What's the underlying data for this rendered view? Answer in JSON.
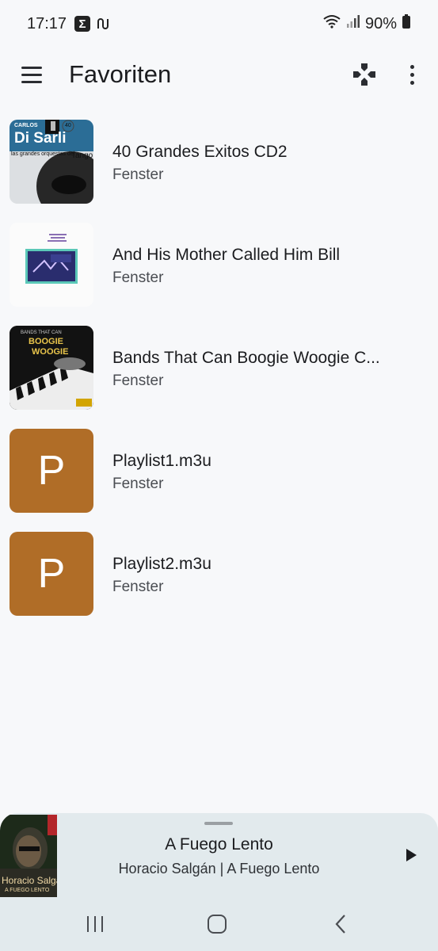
{
  "status": {
    "time": "17:17",
    "sigma_glyph": "Σ",
    "battery": "90%"
  },
  "appbar": {
    "title": "Favoriten"
  },
  "list": [
    {
      "title": "40 Grandes Exitos CD2",
      "subtitle": "Fenster"
    },
    {
      "title": "And His Mother Called Him Bill",
      "subtitle": "Fenster"
    },
    {
      "title": "Bands That Can Boogie Woogie C...",
      "subtitle": "Fenster"
    },
    {
      "title": "Playlist1.m3u",
      "subtitle": "Fenster",
      "letter": "P",
      "color": "#b06d27"
    },
    {
      "title": "Playlist2.m3u",
      "subtitle": "Fenster",
      "letter": "P",
      "color": "#b06d27"
    }
  ],
  "cover_text": {
    "disarli_artist": "CARLOS",
    "disarli_name": "Di Sarli",
    "disarli_sub": "las grandes orquestas del",
    "disarli_genre": "Tango",
    "disarli_num": "40",
    "boogie_band": "BANDS THAT CAN",
    "boogie_title1": "BOOGIE",
    "boogie_title2": "WOOGIE",
    "player_art_name": "Horacio Salgán",
    "player_art_sub": "A FUEGO LENTO"
  },
  "player": {
    "title": "A Fuego Lento",
    "subtitle": "Horacio Salgán | A Fuego Lento"
  },
  "colors": {
    "background": "#f7f8fa",
    "player_bg": "#e2eaed",
    "playlist_tile": "#b06d27"
  }
}
